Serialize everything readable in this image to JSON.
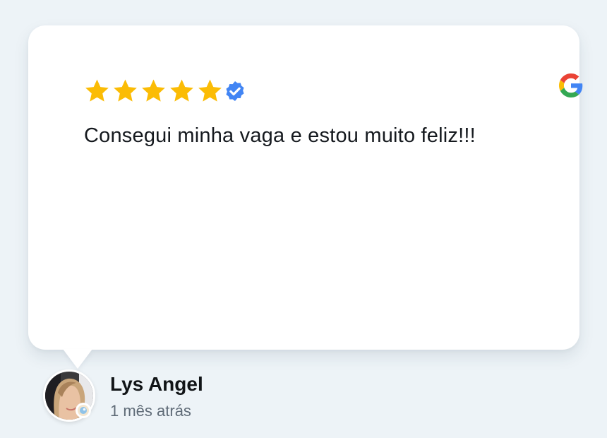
{
  "review": {
    "rating": 5,
    "max_rating": 5,
    "verified": true,
    "text": "Consegui minha vaga e estou muito feliz!!!",
    "source_icon": "google-g-icon"
  },
  "author": {
    "name": "Lys Angel",
    "date": "1 mês atrás",
    "avatar_icon": "user-avatar-photo"
  },
  "colors": {
    "background": "#edf3f7",
    "card": "#ffffff",
    "star": "#fbbc05",
    "verified": "#4285f4",
    "text": "#15191e",
    "muted": "#5f6b77"
  }
}
